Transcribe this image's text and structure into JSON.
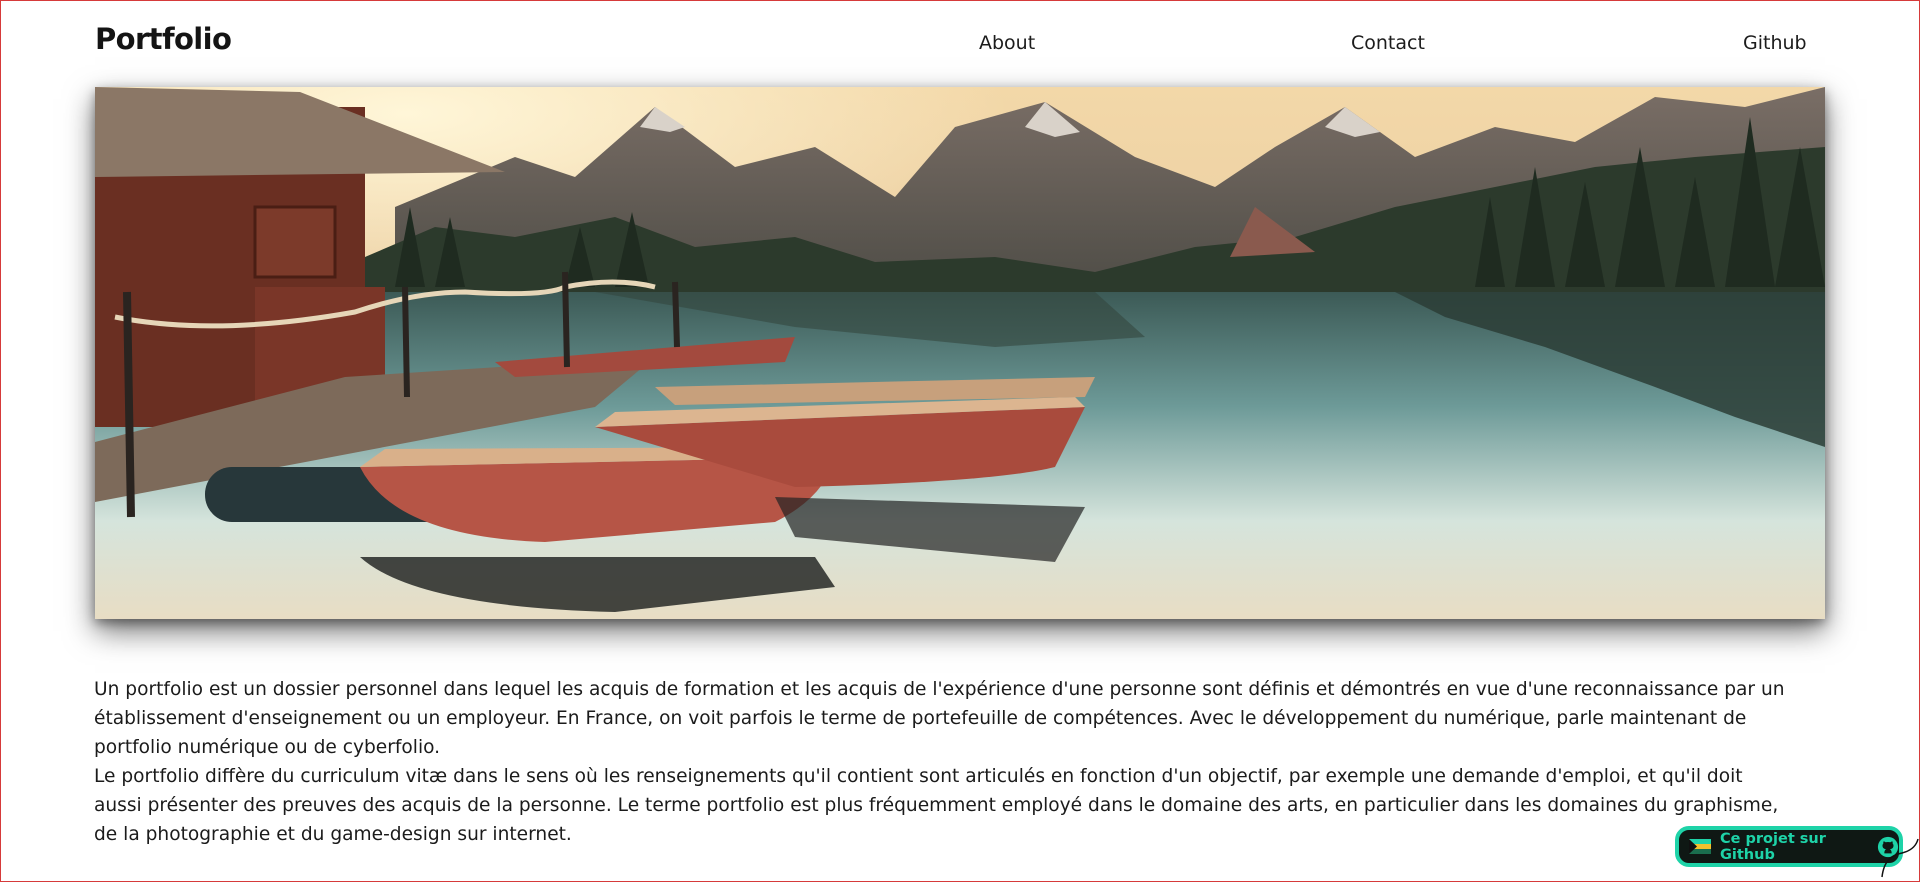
{
  "nav": {
    "brand": "Portfolio",
    "links": [
      {
        "label": "About"
      },
      {
        "label": "Contact"
      },
      {
        "label": "Github"
      }
    ]
  },
  "hero": {
    "image_icon": "lake-boats-landscape-photo"
  },
  "content": {
    "paragraph_1": "Un portfolio est un dossier personnel dans lequel les acquis de formation et les acquis de l'expérience d'une personne sont définis et démontrés en vue d'une reconnaissance par un établissement d'enseignement ou un employeur. En France, on voit parfois le terme de portefeuille de compétences. Avec le développement du numérique, parle maintenant de portfolio numérique ou de cyberfolio.",
    "paragraph_2": "Le portfolio diffère du curriculum vitæ dans le sens où les renseignements qu'il contient sont articulés en fonction d'un objectif, par exemple une demande d'emploi, et qu'il doit aussi présenter des preuves des acquis de la personne. Le terme portfolio est plus fréquemment employé dans le domaine des arts, en particulier dans les domaines du graphisme, de la photographie et du game-design sur internet."
  },
  "github_badge": {
    "label": "Ce projet sur Github",
    "icon": "github-icon",
    "flag_icon": "flag-icon"
  },
  "colors": {
    "accent": "#1ed3a8",
    "badge_bg": "#0f1814",
    "frame_border": "#d63a3a"
  }
}
